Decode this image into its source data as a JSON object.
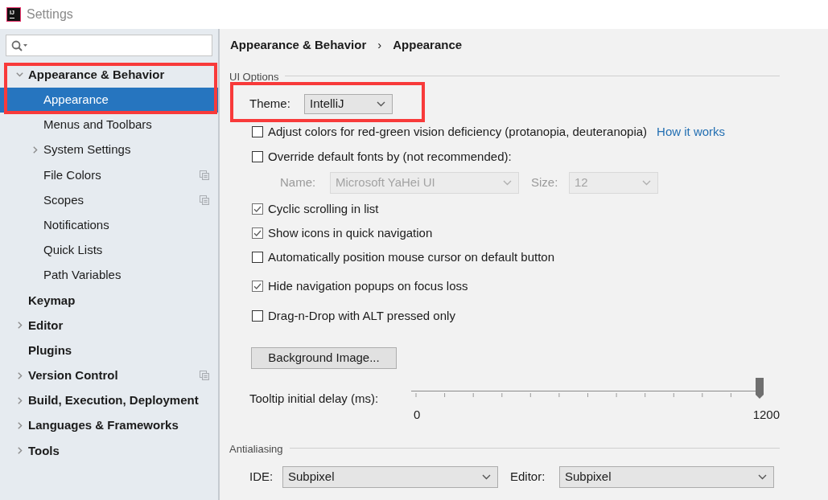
{
  "window": {
    "title": "Settings",
    "logo_text": "IJ"
  },
  "sidebar": {
    "items": [
      {
        "label": "Appearance & Behavior",
        "expanded": true,
        "selected": false,
        "highlighted": true,
        "project_icon": false,
        "children": [
          {
            "label": "Appearance",
            "selected": true,
            "highlighted": true,
            "project_icon": false
          },
          {
            "label": "Menus and Toolbars",
            "selected": false,
            "highlighted": false,
            "project_icon": false
          },
          {
            "label": "System Settings",
            "expanded": false,
            "selected": false,
            "highlighted": false,
            "project_icon": false
          },
          {
            "label": "File Colors",
            "selected": false,
            "highlighted": false,
            "project_icon": true
          },
          {
            "label": "Scopes",
            "selected": false,
            "highlighted": false,
            "project_icon": true
          },
          {
            "label": "Notifications",
            "selected": false,
            "highlighted": false,
            "project_icon": false
          },
          {
            "label": "Quick Lists",
            "selected": false,
            "highlighted": false,
            "project_icon": false
          },
          {
            "label": "Path Variables",
            "selected": false,
            "highlighted": false,
            "project_icon": false
          }
        ]
      },
      {
        "label": "Keymap",
        "selected": false,
        "highlighted": false,
        "project_icon": false
      },
      {
        "label": "Editor",
        "expanded": false,
        "selected": false,
        "highlighted": false,
        "project_icon": false
      },
      {
        "label": "Plugins",
        "selected": false,
        "highlighted": false,
        "project_icon": false
      },
      {
        "label": "Version Control",
        "expanded": false,
        "selected": false,
        "highlighted": false,
        "project_icon": true
      },
      {
        "label": "Build, Execution, Deployment",
        "expanded": false,
        "selected": false,
        "highlighted": false,
        "project_icon": false
      },
      {
        "label": "Languages & Frameworks",
        "expanded": false,
        "selected": false,
        "highlighted": false,
        "project_icon": false
      },
      {
        "label": "Tools",
        "expanded": false,
        "selected": false,
        "highlighted": false,
        "project_icon": false
      }
    ]
  },
  "breadcrumb": {
    "parts": [
      "Appearance & Behavior",
      "Appearance"
    ],
    "separator": "›"
  },
  "ui_options": {
    "title": "UI Options",
    "theme": {
      "label": "Theme:",
      "value": "IntelliJ",
      "highlighted": true
    },
    "options": [
      {
        "kind": "checkbox",
        "label": "Adjust colors for red-green vision deficiency (protanopia, deuteranopia)",
        "checked": false,
        "link": "How it works"
      },
      {
        "kind": "checkbox",
        "label": "Override default fonts by (not recommended):",
        "checked": false
      },
      {
        "kind": "font_fields",
        "name_label": "Name:",
        "name_value": "Microsoft YaHei UI",
        "size_label": "Size:",
        "size_value": "12",
        "disabled": true
      },
      {
        "kind": "checkbox",
        "label": "Cyclic scrolling in list",
        "checked": true
      },
      {
        "kind": "checkbox",
        "label": "Show icons in quick navigation",
        "checked": true
      },
      {
        "kind": "checkbox",
        "label": "Automatically position mouse cursor on default button",
        "checked": false
      },
      {
        "kind": "checkbox",
        "label": "Hide navigation popups on focus loss",
        "checked": true
      },
      {
        "kind": "checkbox",
        "label": "Drag-n-Drop with ALT pressed only",
        "checked": false
      },
      {
        "kind": "button",
        "label": "Background Image..."
      },
      {
        "kind": "slider",
        "label": "Tooltip initial delay (ms):",
        "level": 1,
        "min_label": "0",
        "max_label": "1200"
      }
    ]
  },
  "antialiasing": {
    "title": "Antialiasing",
    "fields": [
      {
        "label": "IDE:",
        "value": "Subpixel"
      },
      {
        "label": "Editor:",
        "value": "Subpixel"
      }
    ]
  }
}
